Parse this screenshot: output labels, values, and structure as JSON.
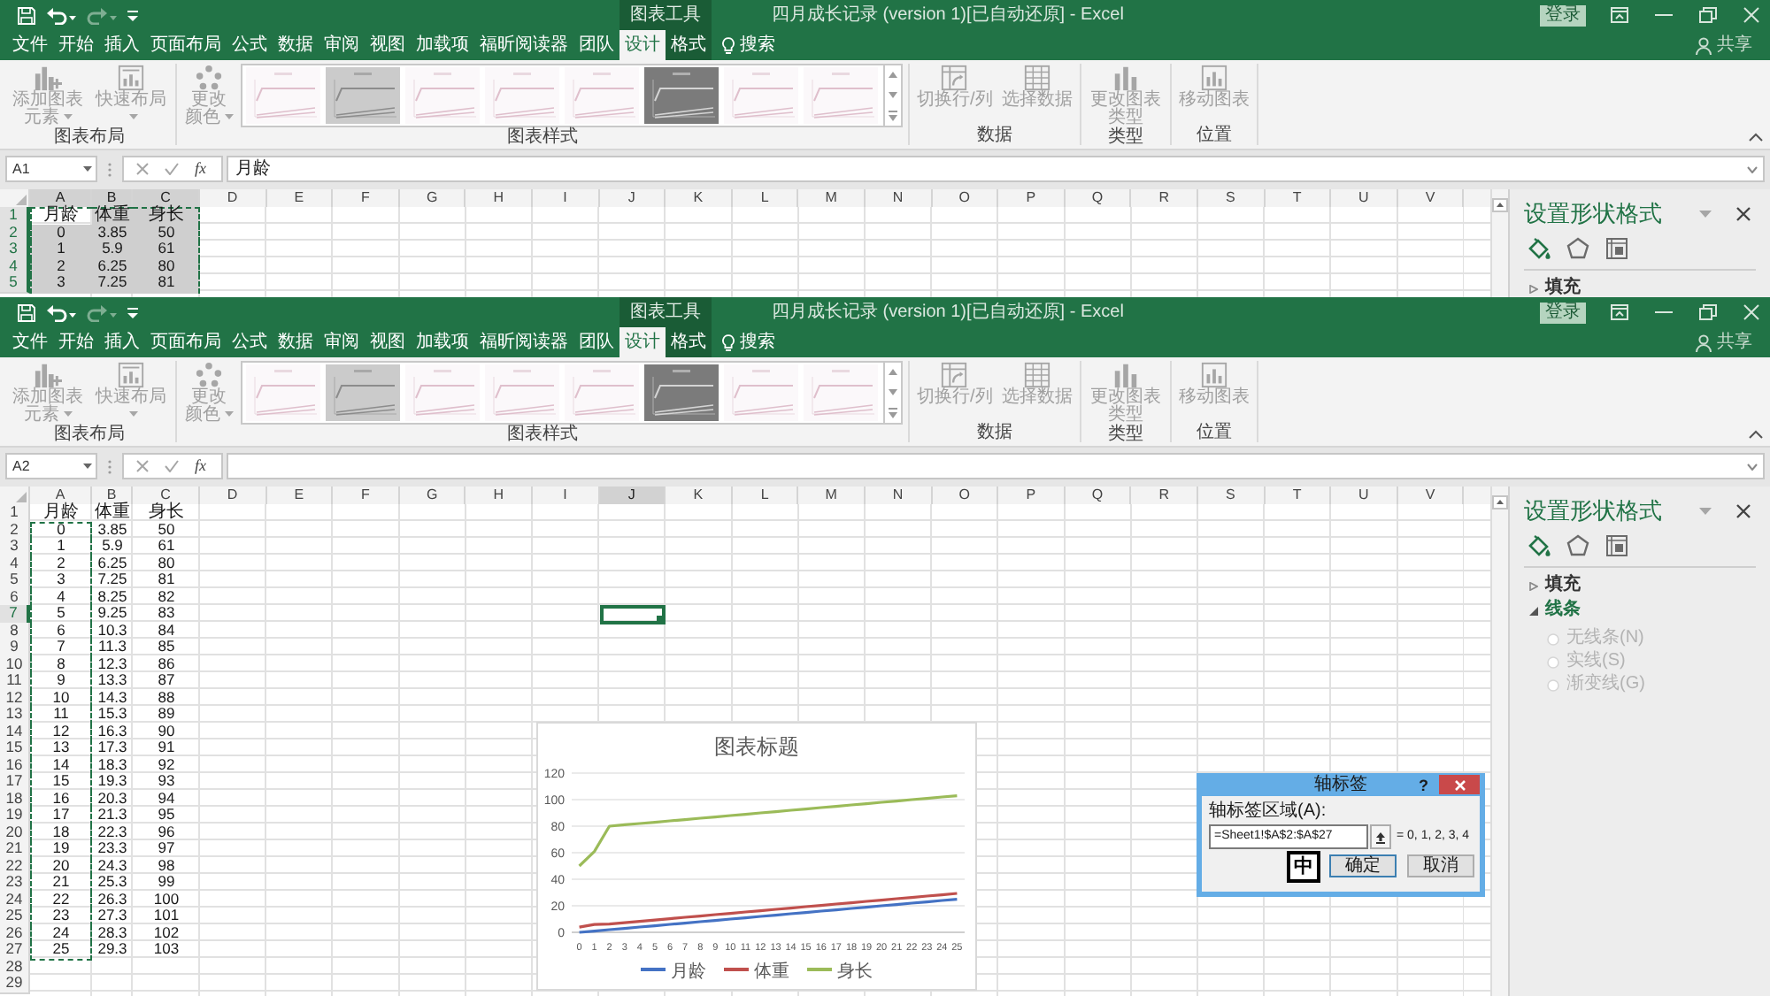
{
  "windows": [
    {
      "context_label": "图表工具",
      "title": "四月成长记录 (version 1)[已自动还原] - Excel",
      "sign_in": "登录",
      "quick_access": [
        {
          "kind": "save",
          "disabled": false
        },
        {
          "kind": "undo",
          "disabled": false
        },
        {
          "kind": "redo",
          "disabled": true
        },
        {
          "kind": "customize",
          "disabled": false
        }
      ],
      "tabs": [
        {
          "label": "文件",
          "selected": false,
          "contextual": false
        },
        {
          "label": "开始",
          "selected": false,
          "contextual": false
        },
        {
          "label": "插入",
          "selected": false,
          "contextual": false
        },
        {
          "label": "页面布局",
          "selected": false,
          "contextual": false
        },
        {
          "label": "公式",
          "selected": false,
          "contextual": false
        },
        {
          "label": "数据",
          "selected": false,
          "contextual": false
        },
        {
          "label": "审阅",
          "selected": false,
          "contextual": false
        },
        {
          "label": "视图",
          "selected": false,
          "contextual": false
        },
        {
          "label": "加载项",
          "selected": false,
          "contextual": false
        },
        {
          "label": "福昕阅读器",
          "selected": false,
          "contextual": false
        },
        {
          "label": "团队",
          "selected": false,
          "contextual": false
        },
        {
          "label": "设计",
          "selected": true,
          "contextual": true
        },
        {
          "label": "格式",
          "selected": false,
          "contextual": true
        }
      ],
      "search": "搜索",
      "share": "共享",
      "ribbon": {
        "groups": [
          {
            "label": "图表布局",
            "commands": [
              {
                "kind": "add-element",
                "label": "添加图表元素",
                "menu": true,
                "disabled": true
              },
              {
                "kind": "quick-layout",
                "label": "快速布局",
                "menu": true,
                "disabled": true
              }
            ]
          },
          {
            "label": "图表样式",
            "commands": [
              {
                "kind": "change-colors",
                "label": "更改颜色",
                "menu": true,
                "disabled": true
              }
            ],
            "gallery": [
              {
                "kind": "light"
              },
              {
                "kind": "shaded"
              },
              {
                "kind": "light"
              },
              {
                "kind": "light"
              },
              {
                "kind": "light"
              },
              {
                "kind": "dark"
              },
              {
                "kind": "light"
              },
              {
                "kind": "light"
              }
            ]
          },
          {
            "label": "数据",
            "commands": [
              {
                "kind": "switch-row-column",
                "label": "切换行/列",
                "menu": false,
                "disabled": true
              },
              {
                "kind": "select-data",
                "label": "选择数据",
                "menu": false,
                "disabled": true
              }
            ]
          },
          {
            "label": "类型",
            "commands": [
              {
                "kind": "change-type",
                "label": "更改图表类型",
                "menu": false,
                "disabled": true
              }
            ]
          },
          {
            "label": "位置",
            "commands": [
              {
                "kind": "move-chart",
                "label": "移动图表",
                "menu": false,
                "disabled": true
              }
            ]
          }
        ]
      },
      "name_box": "A1",
      "function_button": "fx",
      "formula": "月龄",
      "sheet": {
        "cursor": false,
        "columns": [
          {
            "label": "A",
            "selected": true
          },
          {
            "label": "B",
            "selected": true
          },
          {
            "label": "C",
            "selected": true
          },
          {
            "label": "D",
            "selected": false
          },
          {
            "label": "E",
            "selected": false
          },
          {
            "label": "F",
            "selected": false
          },
          {
            "label": "G",
            "selected": false
          },
          {
            "label": "H",
            "selected": false
          },
          {
            "label": "I",
            "selected": false
          },
          {
            "label": "J",
            "selected": false
          },
          {
            "label": "K",
            "selected": false
          },
          {
            "label": "L",
            "selected": false
          },
          {
            "label": "M",
            "selected": false
          },
          {
            "label": "N",
            "selected": false
          },
          {
            "label": "O",
            "selected": false
          },
          {
            "label": "P",
            "selected": false
          },
          {
            "label": "Q",
            "selected": false
          },
          {
            "label": "R",
            "selected": false
          },
          {
            "label": "S",
            "selected": false
          },
          {
            "label": "T",
            "selected": false
          },
          {
            "label": "U",
            "selected": false
          },
          {
            "label": "V",
            "selected": false
          }
        ],
        "rows": [
          {
            "label": "1",
            "selected": true,
            "cells": [
              {
                "text": "月龄",
                "selected": false,
                "marked": true
              },
              {
                "text": "体重",
                "selected": true,
                "marked": true
              },
              {
                "text": "身长",
                "selected": true,
                "marked": true
              }
            ]
          },
          {
            "label": "2",
            "selected": true,
            "cells": [
              {
                "text": "0",
                "selected": true,
                "marked": true
              },
              {
                "text": "3.85",
                "selected": true,
                "marked": true
              },
              {
                "text": "50",
                "selected": true,
                "marked": true
              }
            ]
          },
          {
            "label": "3",
            "selected": true,
            "cells": [
              {
                "text": "1",
                "selected": true,
                "marked": true
              },
              {
                "text": "5.9",
                "selected": true,
                "marked": true
              },
              {
                "text": "61",
                "selected": true,
                "marked": true
              }
            ]
          },
          {
            "label": "4",
            "selected": true,
            "cells": [
              {
                "text": "2",
                "selected": true,
                "marked": true
              },
              {
                "text": "6.25",
                "selected": true,
                "marked": true
              },
              {
                "text": "80",
                "selected": true,
                "marked": true
              }
            ]
          },
          {
            "label": "5",
            "selected": true,
            "cells": [
              {
                "text": "3",
                "selected": true,
                "marked": true
              },
              {
                "text": "7.25",
                "selected": true,
                "marked": true
              },
              {
                "text": "81",
                "selected": true,
                "marked": true
              }
            ]
          }
        ]
      },
      "format_pane": {
        "title": "设置形状格式",
        "tabs": [
          {
            "kind": "fill",
            "selected": true
          },
          {
            "kind": "effects",
            "selected": false
          },
          {
            "kind": "size",
            "selected": false
          }
        ],
        "sections": [
          {
            "label": "填充",
            "expanded": false
          }
        ]
      }
    },
    {
      "context_label": "图表工具",
      "title": "四月成长记录 (version 1)[已自动还原] - Excel",
      "sign_in": "登录",
      "quick_access": [
        {
          "kind": "save",
          "disabled": false
        },
        {
          "kind": "undo",
          "disabled": false
        },
        {
          "kind": "redo",
          "disabled": true
        },
        {
          "kind": "customize",
          "disabled": false
        }
      ],
      "tabs": [
        {
          "label": "文件",
          "selected": false,
          "contextual": false
        },
        {
          "label": "开始",
          "selected": false,
          "contextual": false
        },
        {
          "label": "插入",
          "selected": false,
          "contextual": false
        },
        {
          "label": "页面布局",
          "selected": false,
          "contextual": false
        },
        {
          "label": "公式",
          "selected": false,
          "contextual": false
        },
        {
          "label": "数据",
          "selected": false,
          "contextual": false
        },
        {
          "label": "审阅",
          "selected": false,
          "contextual": false
        },
        {
          "label": "视图",
          "selected": false,
          "contextual": false
        },
        {
          "label": "加载项",
          "selected": false,
          "contextual": false
        },
        {
          "label": "福昕阅读器",
          "selected": false,
          "contextual": false
        },
        {
          "label": "团队",
          "selected": false,
          "contextual": false
        },
        {
          "label": "设计",
          "selected": true,
          "contextual": true
        },
        {
          "label": "格式",
          "selected": false,
          "contextual": true
        }
      ],
      "search": "搜索",
      "share": "共享",
      "ribbon": {
        "groups": [
          {
            "label": "图表布局",
            "commands": [
              {
                "kind": "add-element",
                "label": "添加图表元素",
                "menu": true,
                "disabled": true
              },
              {
                "kind": "quick-layout",
                "label": "快速布局",
                "menu": true,
                "disabled": true
              }
            ]
          },
          {
            "label": "图表样式",
            "commands": [
              {
                "kind": "change-colors",
                "label": "更改颜色",
                "menu": true,
                "disabled": true
              }
            ],
            "gallery": [
              {
                "kind": "light"
              },
              {
                "kind": "shaded"
              },
              {
                "kind": "light"
              },
              {
                "kind": "light"
              },
              {
                "kind": "light"
              },
              {
                "kind": "dark"
              },
              {
                "kind": "light"
              },
              {
                "kind": "light"
              }
            ]
          },
          {
            "label": "数据",
            "commands": [
              {
                "kind": "switch-row-column",
                "label": "切换行/列",
                "menu": false,
                "disabled": true
              },
              {
                "kind": "select-data",
                "label": "选择数据",
                "menu": false,
                "disabled": true
              }
            ]
          },
          {
            "label": "类型",
            "commands": [
              {
                "kind": "change-type",
                "label": "更改图表类型",
                "menu": false,
                "disabled": true
              }
            ]
          },
          {
            "label": "位置",
            "commands": [
              {
                "kind": "move-chart",
                "label": "移动图表",
                "menu": false,
                "disabled": true
              }
            ]
          }
        ]
      },
      "name_box": "A2",
      "function_button": "fx",
      "sheet": {
        "cursor": true,
        "columns": [
          {
            "label": "A",
            "selected": false
          },
          {
            "label": "B",
            "selected": false
          },
          {
            "label": "C",
            "selected": false
          },
          {
            "label": "D",
            "selected": false
          },
          {
            "label": "E",
            "selected": false
          },
          {
            "label": "F",
            "selected": false
          },
          {
            "label": "G",
            "selected": false
          },
          {
            "label": "H",
            "selected": false
          },
          {
            "label": "I",
            "selected": false
          },
          {
            "label": "J",
            "selected": true
          },
          {
            "label": "K",
            "selected": false
          },
          {
            "label": "L",
            "selected": false
          },
          {
            "label": "M",
            "selected": false
          },
          {
            "label": "N",
            "selected": false
          },
          {
            "label": "O",
            "selected": false
          },
          {
            "label": "P",
            "selected": false
          },
          {
            "label": "Q",
            "selected": false
          },
          {
            "label": "R",
            "selected": false
          },
          {
            "label": "S",
            "selected": false
          },
          {
            "label": "T",
            "selected": false
          },
          {
            "label": "U",
            "selected": false
          },
          {
            "label": "V",
            "selected": false
          }
        ],
        "rows": [
          {
            "label": "1",
            "selected": false,
            "cells": [
              {
                "text": "月龄",
                "selected": false,
                "marked": false
              },
              {
                "text": "体重",
                "selected": false,
                "marked": false
              },
              {
                "text": "身长",
                "selected": false,
                "marked": false
              }
            ]
          },
          {
            "label": "2",
            "selected": false,
            "cells": [
              {
                "text": "0",
                "selected": false,
                "marked": true
              },
              {
                "text": "3.85",
                "selected": false,
                "marked": false
              },
              {
                "text": "50",
                "selected": false,
                "marked": false
              }
            ]
          },
          {
            "label": "3",
            "selected": false,
            "cells": [
              {
                "text": "1",
                "selected": false,
                "marked": true
              },
              {
                "text": "5.9",
                "selected": false,
                "marked": false
              },
              {
                "text": "61",
                "selected": false,
                "marked": false
              }
            ]
          },
          {
            "label": "4",
            "selected": false,
            "cells": [
              {
                "text": "2",
                "selected": false,
                "marked": true
              },
              {
                "text": "6.25",
                "selected": false,
                "marked": false
              },
              {
                "text": "80",
                "selected": false,
                "marked": false
              }
            ]
          },
          {
            "label": "5",
            "selected": false,
            "cells": [
              {
                "text": "3",
                "selected": false,
                "marked": true
              },
              {
                "text": "7.25",
                "selected": false,
                "marked": false
              },
              {
                "text": "81",
                "selected": false,
                "marked": false
              }
            ]
          },
          {
            "label": "6",
            "selected": false,
            "cells": [
              {
                "text": "4",
                "selected": false,
                "marked": true
              },
              {
                "text": "8.25",
                "selected": false,
                "marked": false
              },
              {
                "text": "82",
                "selected": false,
                "marked": false
              }
            ]
          },
          {
            "label": "7",
            "selected": true,
            "cells": [
              {
                "text": "5",
                "selected": false,
                "marked": true
              },
              {
                "text": "9.25",
                "selected": false,
                "marked": false
              },
              {
                "text": "83",
                "selected": false,
                "marked": false
              }
            ]
          },
          {
            "label": "8",
            "selected": false,
            "cells": [
              {
                "text": "6",
                "selected": false,
                "marked": true
              },
              {
                "text": "10.3",
                "selected": false,
                "marked": false
              },
              {
                "text": "84",
                "selected": false,
                "marked": false
              }
            ]
          },
          {
            "label": "9",
            "selected": false,
            "cells": [
              {
                "text": "7",
                "selected": false,
                "marked": true
              },
              {
                "text": "11.3",
                "selected": false,
                "marked": false
              },
              {
                "text": "85",
                "selected": false,
                "marked": false
              }
            ]
          },
          {
            "label": "10",
            "selected": false,
            "cells": [
              {
                "text": "8",
                "selected": false,
                "marked": true
              },
              {
                "text": "12.3",
                "selected": false,
                "marked": false
              },
              {
                "text": "86",
                "selected": false,
                "marked": false
              }
            ]
          },
          {
            "label": "11",
            "selected": false,
            "cells": [
              {
                "text": "9",
                "selected": false,
                "marked": true
              },
              {
                "text": "13.3",
                "selected": false,
                "marked": false
              },
              {
                "text": "87",
                "selected": false,
                "marked": false
              }
            ]
          },
          {
            "label": "12",
            "selected": false,
            "cells": [
              {
                "text": "10",
                "selected": false,
                "marked": true
              },
              {
                "text": "14.3",
                "selected": false,
                "marked": false
              },
              {
                "text": "88",
                "selected": false,
                "marked": false
              }
            ]
          },
          {
            "label": "13",
            "selected": false,
            "cells": [
              {
                "text": "11",
                "selected": false,
                "marked": true
              },
              {
                "text": "15.3",
                "selected": false,
                "marked": false
              },
              {
                "text": "89",
                "selected": false,
                "marked": false
              }
            ]
          },
          {
            "label": "14",
            "selected": false,
            "cells": [
              {
                "text": "12",
                "selected": false,
                "marked": true
              },
              {
                "text": "16.3",
                "selected": false,
                "marked": false
              },
              {
                "text": "90",
                "selected": false,
                "marked": false
              }
            ]
          },
          {
            "label": "15",
            "selected": false,
            "cells": [
              {
                "text": "13",
                "selected": false,
                "marked": true
              },
              {
                "text": "17.3",
                "selected": false,
                "marked": false
              },
              {
                "text": "91",
                "selected": false,
                "marked": false
              }
            ]
          },
          {
            "label": "16",
            "selected": false,
            "cells": [
              {
                "text": "14",
                "selected": false,
                "marked": true
              },
              {
                "text": "18.3",
                "selected": false,
                "marked": false
              },
              {
                "text": "92",
                "selected": false,
                "marked": false
              }
            ]
          },
          {
            "label": "17",
            "selected": false,
            "cells": [
              {
                "text": "15",
                "selected": false,
                "marked": true
              },
              {
                "text": "19.3",
                "selected": false,
                "marked": false
              },
              {
                "text": "93",
                "selected": false,
                "marked": false
              }
            ]
          },
          {
            "label": "18",
            "selected": false,
            "cells": [
              {
                "text": "16",
                "selected": false,
                "marked": true
              },
              {
                "text": "20.3",
                "selected": false,
                "marked": false
              },
              {
                "text": "94",
                "selected": false,
                "marked": false
              }
            ]
          },
          {
            "label": "19",
            "selected": false,
            "cells": [
              {
                "text": "17",
                "selected": false,
                "marked": true
              },
              {
                "text": "21.3",
                "selected": false,
                "marked": false
              },
              {
                "text": "95",
                "selected": false,
                "marked": false
              }
            ]
          },
          {
            "label": "20",
            "selected": false,
            "cells": [
              {
                "text": "18",
                "selected": false,
                "marked": true
              },
              {
                "text": "22.3",
                "selected": false,
                "marked": false
              },
              {
                "text": "96",
                "selected": false,
                "marked": false
              }
            ]
          },
          {
            "label": "21",
            "selected": false,
            "cells": [
              {
                "text": "19",
                "selected": false,
                "marked": true
              },
              {
                "text": "23.3",
                "selected": false,
                "marked": false
              },
              {
                "text": "97",
                "selected": false,
                "marked": false
              }
            ]
          },
          {
            "label": "22",
            "selected": false,
            "cells": [
              {
                "text": "20",
                "selected": false,
                "marked": true
              },
              {
                "text": "24.3",
                "selected": false,
                "marked": false
              },
              {
                "text": "98",
                "selected": false,
                "marked": false
              }
            ]
          },
          {
            "label": "23",
            "selected": false,
            "cells": [
              {
                "text": "21",
                "selected": false,
                "marked": true
              },
              {
                "text": "25.3",
                "selected": false,
                "marked": false
              },
              {
                "text": "99",
                "selected": false,
                "marked": false
              }
            ]
          },
          {
            "label": "24",
            "selected": false,
            "cells": [
              {
                "text": "22",
                "selected": false,
                "marked": true
              },
              {
                "text": "26.3",
                "selected": false,
                "marked": false
              },
              {
                "text": "100",
                "selected": false,
                "marked": false
              }
            ]
          },
          {
            "label": "25",
            "selected": false,
            "cells": [
              {
                "text": "23",
                "selected": false,
                "marked": true
              },
              {
                "text": "27.3",
                "selected": false,
                "marked": false
              },
              {
                "text": "101",
                "selected": false,
                "marked": false
              }
            ]
          },
          {
            "label": "26",
            "selected": false,
            "cells": [
              {
                "text": "24",
                "selected": false,
                "marked": true
              },
              {
                "text": "28.3",
                "selected": false,
                "marked": false
              },
              {
                "text": "102",
                "selected": false,
                "marked": false
              }
            ]
          },
          {
            "label": "27",
            "selected": false,
            "cells": [
              {
                "text": "25",
                "selected": false,
                "marked": true
              },
              {
                "text": "29.3",
                "selected": false,
                "marked": false
              },
              {
                "text": "103",
                "selected": false,
                "marked": false
              }
            ]
          },
          {
            "label": "28",
            "selected": false
          },
          {
            "label": "29",
            "selected": false
          }
        ]
      },
      "format_pane": {
        "title": "设置形状格式",
        "tabs": [
          {
            "kind": "fill",
            "selected": true
          },
          {
            "kind": "effects",
            "selected": false
          },
          {
            "kind": "size",
            "selected": false
          }
        ],
        "sections": [
          {
            "label": "填充",
            "expanded": false
          },
          {
            "label": "线条",
            "expanded": true,
            "options": [
              {
                "label": "无线条(N)",
                "selected": false,
                "disabled": true
              },
              {
                "label": "实线(S)",
                "selected": false,
                "disabled": true
              },
              {
                "label": "渐变线(G)",
                "selected": false,
                "disabled": true
              }
            ]
          }
        ]
      },
      "chart": {
        "chart_data": {
          "type": "line",
          "title": "图表标题",
          "x": [
            0,
            1,
            2,
            3,
            4,
            5,
            6,
            7,
            8,
            9,
            10,
            11,
            12,
            13,
            14,
            15,
            16,
            17,
            18,
            19,
            20,
            21,
            22,
            23,
            24,
            25
          ],
          "series": [
            {
              "name": "月龄",
              "color": "#4472c4",
              "values": [
                0,
                1,
                2,
                3,
                4,
                5,
                6,
                7,
                8,
                9,
                10,
                11,
                12,
                13,
                14,
                15,
                16,
                17,
                18,
                19,
                20,
                21,
                22,
                23,
                24,
                25
              ]
            },
            {
              "name": "体重",
              "color": "#c0504d",
              "values": [
                3.85,
                5.9,
                6.25,
                7.25,
                8.25,
                9.25,
                10.3,
                11.3,
                12.3,
                13.3,
                14.3,
                15.3,
                16.3,
                17.3,
                18.3,
                19.3,
                20.3,
                21.3,
                22.3,
                23.3,
                24.3,
                25.3,
                26.3,
                27.3,
                28.3,
                29.3
              ]
            },
            {
              "name": "身长",
              "color": "#9bbb59",
              "values": [
                50,
                61,
                80,
                81,
                82,
                83,
                84,
                85,
                86,
                87,
                88,
                89,
                90,
                91,
                92,
                93,
                94,
                95,
                96,
                97,
                98,
                99,
                100,
                101,
                102,
                103
              ]
            }
          ],
          "xlim": [
            -0.5,
            25.5
          ],
          "xticks": [
            0,
            1,
            2,
            3,
            4,
            5,
            6,
            7,
            8,
            9,
            10,
            11,
            12,
            13,
            14,
            15,
            16,
            17,
            18,
            19,
            20,
            21,
            22,
            23,
            24,
            25
          ],
          "ylim": [
            0,
            120
          ],
          "yticks": [
            0,
            20,
            40,
            60,
            80,
            100,
            120
          ],
          "grid": true,
          "legend": "bottom"
        }
      },
      "dialog": {
        "title": "轴标签",
        "help": "?",
        "field_label": "轴标签区域(A):",
        "value": "=Sheet1!$A$2:$A$27",
        "preview": "= 0, 1, 2, 3, 4",
        "buttons": [
          {
            "label": "确定",
            "kind": "primary"
          },
          {
            "label": "取消",
            "kind": "cancel"
          }
        ]
      },
      "ime_indicator": "中"
    }
  ]
}
